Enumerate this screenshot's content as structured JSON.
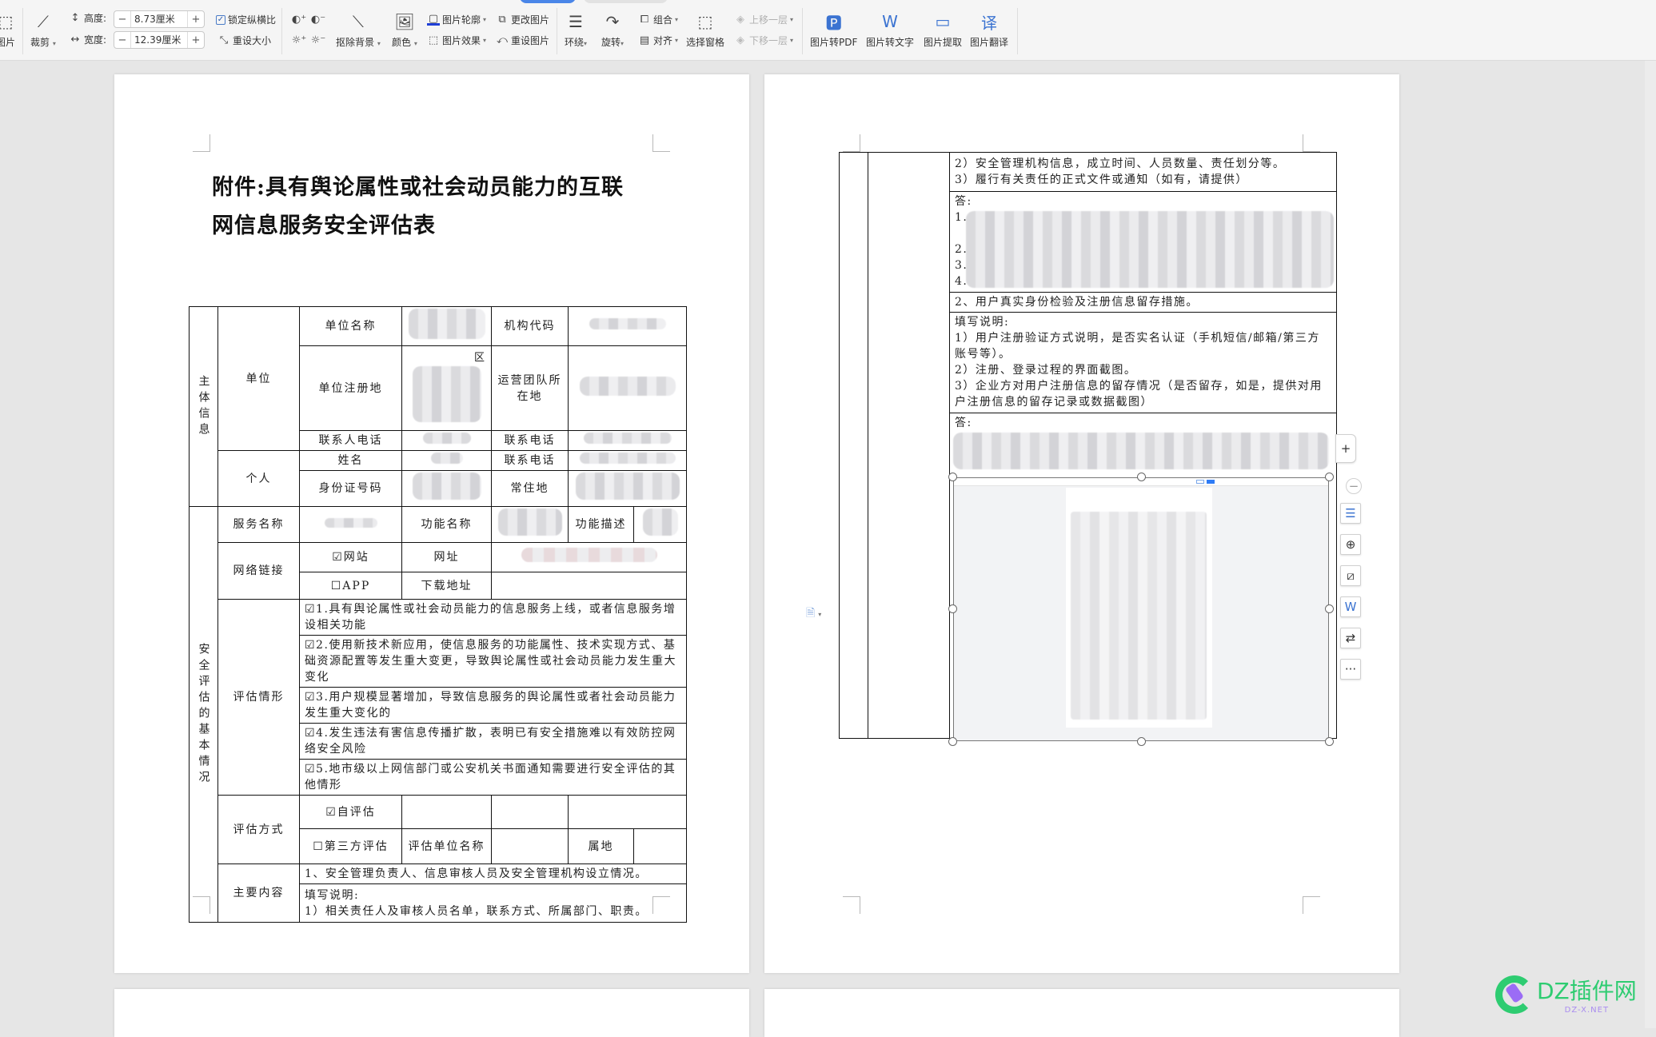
{
  "toolbar": {
    "partial_left_label": "图片",
    "crop_label": "裁剪",
    "height_label": "高度:",
    "height_value": "8.73厘米",
    "width_label": "宽度:",
    "width_value": "12.39厘米",
    "lock_ratio_label": "锁定纵横比",
    "lock_ratio_checked": true,
    "reset_size_label": "重设大小",
    "remove_bg_label": "抠除背景",
    "color_label": "颜色",
    "outline_label": "图片轮廓",
    "effects_label": "图片效果",
    "change_pic_label": "更改图片",
    "reset_pic_label": "重设图片",
    "wrap_label": "环绕",
    "rotate_label": "旋转",
    "group_label": "组合",
    "align_label": "对齐",
    "selection_pane_label": "选择窗格",
    "bring_forward_label": "上移一层",
    "send_backward_label": "下移一层",
    "to_pdf_label": "图片转PDF",
    "to_text_label": "图片转文字",
    "extract_label": "图片提取",
    "translate_label": "图片翻译",
    "minus": "−",
    "plus": "+"
  },
  "left_page": {
    "title_line1": "附件:具有舆论属性或社会动员能力的互联",
    "title_line2": "网信息服务安全评估表",
    "table": {
      "section_subject": "主体信息",
      "unit": "单位",
      "unit_name": "单位名称",
      "org_code": "机构代码",
      "unit_reg_addr": "单位注册地",
      "unit_addr_partial": "区",
      "ops_team_location": "运营团队所在地",
      "contact_phone_person": "联系人电话",
      "contact_phone": "联系电话",
      "personal": "个人",
      "name": "姓名",
      "id_number": "身份证号码",
      "residence": "常住地",
      "section_basic": "安全评估的基本情况",
      "service_name": "服务名称",
      "function_name": "功能名称",
      "function_desc": "功能描述",
      "network_link": "网络链接",
      "website": "☑网站",
      "url": "网址",
      "app": "☐APP",
      "download_addr": "下载地址",
      "assessment_situation": "评估情形",
      "situations": [
        "☑1.具有舆论属性或社会动员能力的信息服务上线，或者信息服务增设相关功能",
        "☑2.使用新技术新应用，使信息服务的功能属性、技术实现方式、基础资源配置等发生重大变更，导致舆论属性或社会动员能力发生重大变化",
        "☑3.用户规模显著增加，导致信息服务的舆论属性或者社会动员能力发生重大变化的",
        "☑4.发生违法有害信息传播扩散，表明已有安全措施难以有效防控网络安全风险",
        "☑5.地市级以上网信部门或公安机关书面通知需要进行安全评估的其他情形"
      ],
      "assessment_method": "评估方式",
      "self_assessment": "☑自评估",
      "third_party": "☐第三方评估",
      "assessor_name": "评估单位名称",
      "jurisdiction": "属地",
      "main_content": "主要内容",
      "content_item1": "1、安全管理负责人、信息审核人员及安全管理机构设立情况。",
      "fill_instructions": "填写说明:",
      "instruction1": "1）相关责任人及审核人员名单，联系方式、所属部门、职责。"
    }
  },
  "right_page": {
    "instructions_cont": [
      "2）安全管理机构信息，成立时间、人员数量、责任划分等。",
      "3）履行有关责任的正式文件或通知（如有，请提供）"
    ],
    "answer_label": "答:",
    "answer_lines": [
      "1.",
      "2.",
      "3.",
      "4."
    ],
    "item2": "2、用户真实身份检验及注册信息留存措施。",
    "fill_instructions": "填写说明:",
    "instructions2": [
      "1）用户注册验证方式说明，是否实名认证（手机短信/邮箱/第三方账号等）。",
      "2）注册、登录过程的界面截图。",
      "3）企业方对用户注册信息的留存情况（是否留存，如是，提供对用户注册信息的留存记录或数据截图）"
    ],
    "answer_label2": "答:"
  },
  "float_toolbar": {
    "add": "+",
    "more": "···"
  },
  "watermark": {
    "brand": "DZ插件网",
    "sub": "DZ-X.NET"
  }
}
